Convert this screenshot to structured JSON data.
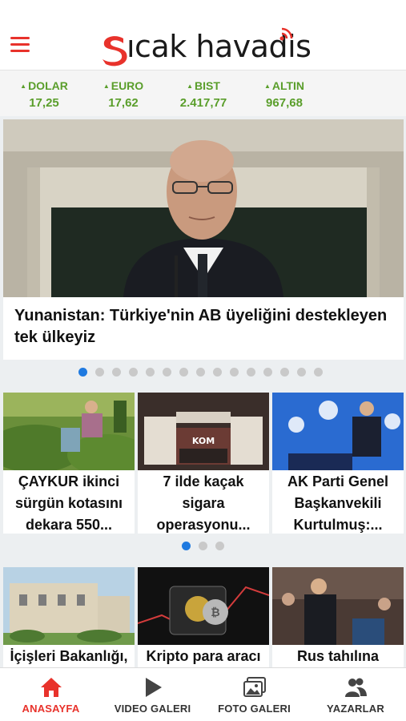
{
  "app": {
    "brand": "ıcak havadis",
    "brand_color": "#e8322b"
  },
  "header": {
    "menu_icon": "hamburger-menu-icon"
  },
  "markets": [
    {
      "name": "DOLAR",
      "value": "17,25",
      "trend": "up"
    },
    {
      "name": "EURO",
      "value": "17,62",
      "trend": "up"
    },
    {
      "name": "BIST",
      "value": "2.417,77",
      "trend": "up"
    },
    {
      "name": "ALTIN",
      "value": "967,68",
      "trend": "up"
    }
  ],
  "hero": {
    "title": "Yunanistan: Türkiye'nin AB üyeliğini destekleyen tek ülkeyiz",
    "slide_count": 15,
    "active_slide": 1
  },
  "news_row1": [
    {
      "title": "ÇAYKUR ikinci sürgün kotasını dekara 550..."
    },
    {
      "title": "7 ilde kaçak sigara operasyonu..."
    },
    {
      "title": "AK Parti Genel Başkanvekili Kurtulmuş:..."
    }
  ],
  "news_row1_pager": {
    "count": 3,
    "active": 1
  },
  "news_row2": [
    {
      "title": "İçişleri Bakanlığı,"
    },
    {
      "title": "Kripto para aracı"
    },
    {
      "title": "Rus tahılına"
    }
  ],
  "tabs": [
    {
      "label": "ANASAYFA",
      "icon": "home-icon",
      "active": true
    },
    {
      "label": "VIDEO GALERI",
      "icon": "play-icon",
      "active": false
    },
    {
      "label": "FOTO GALERI",
      "icon": "photo-gallery-icon",
      "active": false
    },
    {
      "label": "YAZARLAR",
      "icon": "authors-icon",
      "active": false
    }
  ],
  "colors": {
    "accent": "#e8322b",
    "market_green": "#5a9e2b",
    "dot_active": "#1f7ae0"
  }
}
